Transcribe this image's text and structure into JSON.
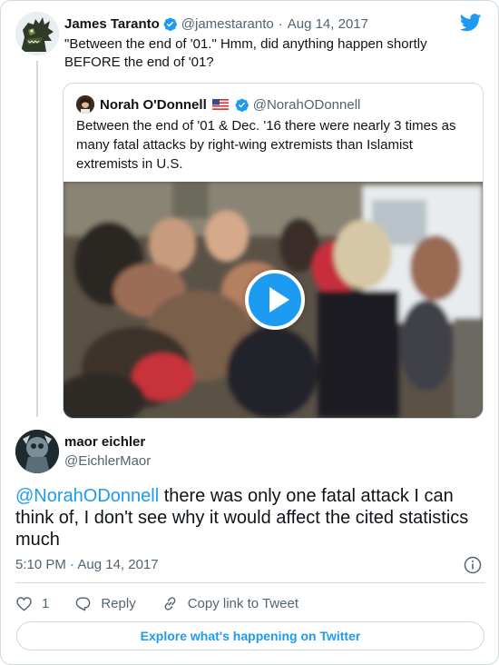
{
  "parent": {
    "name": "James Taranto",
    "handle": "@jamestaranto",
    "separator": "·",
    "date": "Aug 14, 2017",
    "text": "\"Between the end of '01.\" Hmm, did anything happen shortly BEFORE the end of '01?"
  },
  "quoted": {
    "name": "Norah O'Donnell",
    "flag": "us-flag-icon",
    "handle": "@NorahODonnell",
    "text": "Between the end of '01 & Dec. '16 there were nearly 3 times as many fatal attacks by right-wing extremists than Islamist extremists in U.S.",
    "media": {
      "type": "video",
      "play_icon": "play-icon"
    }
  },
  "reply": {
    "name": "maor eichler",
    "handle": "@EichlerMaor",
    "mention": "@NorahODonnell",
    "text": " there was only one fatal attack I can think of, I don't see why it would affect the cited statistics much",
    "time": "5:10 PM · Aug 14, 2017"
  },
  "actions": {
    "like_count": "1",
    "reply_label": "Reply",
    "copy_label": "Copy link to Tweet"
  },
  "explore_label": "Explore what's happening on Twitter",
  "colors": {
    "accent": "#1d9bf0",
    "text": "#0f1419",
    "muted": "#536471",
    "border": "#cfd9de"
  }
}
